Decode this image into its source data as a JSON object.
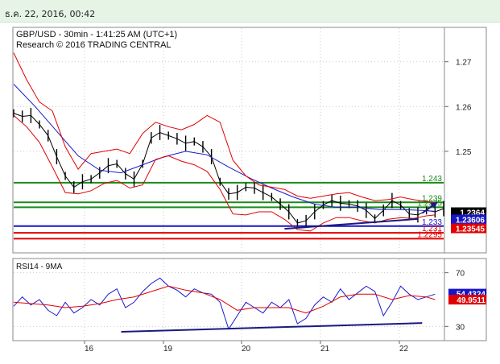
{
  "header": {
    "datetime": "ธ.ค. 22, 2016, 00:42"
  },
  "chart_data": [
    {
      "type": "line",
      "title": "GBP/USD - 30min - 1:41:25 AM (UTC+1)",
      "subtitle": "Research © 2016 TRADING CENTRAL",
      "ylim": [
        1.2275,
        1.2775
      ],
      "y_ticks": [
        1.25,
        1.26,
        1.27
      ],
      "x_ticks": [
        "16",
        "19",
        "20",
        "21",
        "22"
      ],
      "levels": [
        {
          "label": "1.243",
          "value": 1.243,
          "color": "#1a8a1a"
        },
        {
          "label": "1.239",
          "value": 1.2386,
          "color": "#1a8a1a"
        },
        {
          "label": "1.2375",
          "value": 1.2375,
          "color": "#1a8a1a"
        },
        {
          "label": "1.233",
          "value": 1.2333,
          "color": "#1616c8"
        },
        {
          "label": "1.231",
          "value": 1.2318,
          "color": "#e00000"
        },
        {
          "label": "1.2295",
          "value": 1.2305,
          "color": "#e00000"
        }
      ],
      "price_tags": [
        {
          "label": "1.2364",
          "value": 1.2364,
          "bg": "#000000",
          "fg": "#ffffff"
        },
        {
          "label": "1.23606",
          "value": 1.2348,
          "bg": "#1616c8",
          "fg": "#ffffff"
        },
        {
          "label": "1.23545",
          "value": 1.2328,
          "bg": "#e00000",
          "fg": "#ffffff"
        }
      ],
      "series": [
        {
          "kind": "price",
          "color": "#000000",
          "x": [
            0,
            2,
            4,
            6,
            8,
            10,
            12,
            14,
            16,
            18,
            20,
            22,
            24,
            26,
            28,
            30,
            32,
            34,
            36,
            38,
            40,
            42,
            44,
            46,
            48,
            50,
            52,
            54,
            56,
            58,
            60,
            62,
            64,
            66,
            68,
            70,
            72,
            74,
            76,
            78,
            80,
            82,
            84,
            86,
            88,
            90,
            92,
            94,
            96,
            98,
            100
          ],
          "values": [
            1.2585,
            1.2578,
            1.258,
            1.256,
            1.2535,
            1.2488,
            1.2445,
            1.242,
            1.2432,
            1.2438,
            1.2452,
            1.2468,
            1.2472,
            1.245,
            1.2438,
            1.2472,
            1.253,
            1.2542,
            1.2535,
            1.2528,
            1.2518,
            1.2522,
            1.251,
            1.2488,
            1.2432,
            1.2405,
            1.2408,
            1.242,
            1.2418,
            1.2408,
            1.2398,
            1.2382,
            1.2365,
            1.234,
            1.2345,
            1.2365,
            1.238,
            1.239,
            1.2384,
            1.2382,
            1.2378,
            1.2368,
            1.235,
            1.2368,
            1.239,
            1.238,
            1.236,
            1.2358,
            1.2368,
            1.2365,
            1.2372
          ]
        },
        {
          "kind": "moving-average",
          "color": "#1a1ad0",
          "x": [
            0,
            5,
            10,
            15,
            20,
            25,
            30,
            35,
            40,
            45,
            50,
            55,
            60,
            65,
            70,
            75,
            80,
            85,
            90,
            95,
            98
          ],
          "values": [
            1.265,
            1.26,
            1.2545,
            1.249,
            1.2458,
            1.2452,
            1.247,
            1.2488,
            1.25,
            1.2492,
            1.2465,
            1.244,
            1.2418,
            1.2398,
            1.2382,
            1.2375,
            1.2375,
            1.237,
            1.237,
            1.2368,
            1.2366
          ]
        },
        {
          "kind": "bollinger-upper",
          "color": "#e00000",
          "x": [
            0,
            3,
            6,
            9,
            12,
            15,
            18,
            21,
            24,
            27,
            30,
            33,
            36,
            39,
            42,
            45,
            48,
            51,
            54,
            57,
            60,
            63,
            66,
            69,
            72,
            75,
            78,
            81,
            84,
            87,
            90,
            93,
            96,
            98
          ],
          "values": [
            1.272,
            1.266,
            1.261,
            1.259,
            1.251,
            1.246,
            1.2495,
            1.25,
            1.2505,
            1.2495,
            1.254,
            1.2565,
            1.2555,
            1.2548,
            1.256,
            1.258,
            1.2565,
            1.248,
            1.2445,
            1.2425,
            1.242,
            1.2415,
            1.24,
            1.2395,
            1.24,
            1.2405,
            1.2408,
            1.2398,
            1.239,
            1.2392,
            1.2398,
            1.2392,
            1.2388,
            1.2385
          ]
        },
        {
          "kind": "bollinger-lower",
          "color": "#e00000",
          "x": [
            0,
            3,
            6,
            9,
            12,
            15,
            18,
            21,
            24,
            27,
            30,
            33,
            36,
            39,
            42,
            45,
            48,
            51,
            54,
            57,
            60,
            63,
            66,
            69,
            72,
            75,
            78,
            81,
            84,
            87,
            90,
            93,
            96,
            98
          ],
          "values": [
            1.258,
            1.2555,
            1.252,
            1.2465,
            1.2408,
            1.2405,
            1.2412,
            1.2428,
            1.2435,
            1.2418,
            1.2425,
            1.2482,
            1.249,
            1.2478,
            1.247,
            1.2455,
            1.2415,
            1.236,
            1.2358,
            1.2365,
            1.2365,
            1.2348,
            1.2325,
            1.2322,
            1.234,
            1.2352,
            1.2352,
            1.2345,
            1.234,
            1.2348,
            1.2352,
            1.235,
            1.2356,
            1.2358
          ]
        }
      ],
      "trendlines": [
        {
          "color": "#1a1a80",
          "points": [
            [
              63,
              1.2327
            ],
            [
              94,
              1.2349
            ]
          ]
        }
      ],
      "target_arrow": {
        "color": "#1a1a80",
        "from": [
          95,
          1.2362
        ],
        "to": [
          98.5,
          1.2386
        ]
      }
    },
    {
      "type": "line",
      "title": "RSI14 - 9MA",
      "ylim": [
        20,
        80
      ],
      "y_ticks": [
        30,
        70
      ],
      "x_ticks": [
        "16",
        "19",
        "20",
        "21",
        "22"
      ],
      "price_tags": [
        {
          "label": "54.4324",
          "value": 54.4324,
          "bg": "#1616c8",
          "fg": "#ffffff"
        },
        {
          "label": "49.9511",
          "value": 49.9511,
          "bg": "#e00000",
          "fg": "#ffffff"
        }
      ],
      "series": [
        {
          "kind": "rsi",
          "color": "#1a1ad0",
          "x": [
            0,
            2,
            4,
            6,
            8,
            10,
            12,
            14,
            16,
            18,
            20,
            22,
            24,
            26,
            28,
            30,
            32,
            34,
            36,
            38,
            40,
            42,
            44,
            46,
            48,
            50,
            52,
            54,
            56,
            58,
            60,
            62,
            64,
            66,
            68,
            70,
            72,
            74,
            76,
            78,
            80,
            82,
            84,
            86,
            88,
            90,
            92,
            94,
            96,
            98
          ],
          "values": [
            45,
            52,
            46,
            50,
            42,
            38,
            48,
            40,
            44,
            50,
            46,
            54,
            58,
            44,
            48,
            56,
            62,
            66,
            60,
            57,
            52,
            58,
            55,
            54,
            48,
            28,
            38,
            48,
            44,
            40,
            48,
            44,
            50,
            32,
            36,
            46,
            52,
            48,
            58,
            50,
            55,
            60,
            56,
            38,
            48,
            60,
            54,
            50,
            52,
            54
          ]
        },
        {
          "kind": "ma",
          "color": "#e00000",
          "x": [
            0,
            4,
            8,
            12,
            16,
            20,
            24,
            28,
            32,
            36,
            40,
            44,
            48,
            52,
            56,
            60,
            64,
            68,
            72,
            76,
            80,
            84,
            88,
            92,
            96,
            98
          ],
          "values": [
            48,
            47,
            46,
            44,
            45,
            47,
            50,
            52,
            56,
            60,
            57,
            55,
            50,
            42,
            44,
            44,
            44,
            40,
            45,
            52,
            54,
            54,
            50,
            53,
            52,
            50
          ]
        }
      ],
      "trendlines": [
        {
          "color": "#1a1a80",
          "points": [
            [
              25,
              26
            ],
            [
              95,
              32.5
            ]
          ]
        }
      ]
    }
  ]
}
